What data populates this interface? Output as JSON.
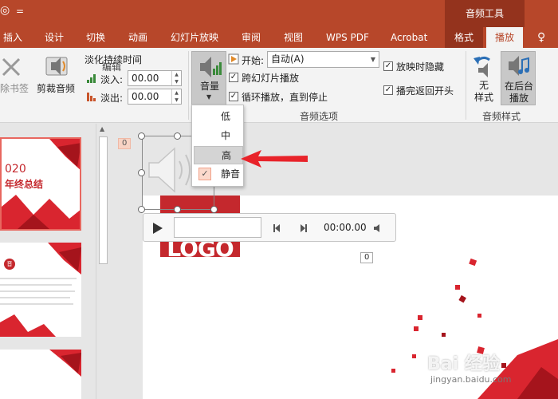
{
  "titlebar": {
    "qa_dropdown": "=",
    "context_group": "音频工具"
  },
  "tabs": [
    "插入",
    "设计",
    "切换",
    "动画",
    "幻灯片放映",
    "审阅",
    "视图",
    "WPS PDF",
    "Acrobat",
    "格式",
    "播放"
  ],
  "help_glyph": "♀",
  "ribbon": {
    "bookmark_label": "除书签",
    "trim_label": "剪裁音频",
    "fade_title": "淡化持续时间",
    "fade_in_label": "淡入:",
    "fade_in_value": "00.00",
    "fade_out_label": "淡出:",
    "fade_out_value": "00.00",
    "edit_group": "编辑",
    "volume_label": "音量",
    "start_label": "开始:",
    "start_value": "自动(A)",
    "cross_slides_label": "跨幻灯片播放",
    "loop_label": "循环播放，直到停止",
    "hide_label": "放映时隐藏",
    "rewind_label": "播完返回开头",
    "audio_options_group": "音频选项",
    "none_style_line1": "无",
    "none_style_line2": "样式",
    "bg_line1": "在后台",
    "bg_line2": "播放",
    "audio_style_group": "音频样式",
    "check_mark": "✓"
  },
  "volume_menu": {
    "items": [
      "低",
      "中",
      "高",
      "静音"
    ],
    "check_mark": "✓"
  },
  "slide_thumbs": {
    "thumb1_year": "020",
    "thumb1_title": "年终总结",
    "thumb2_badge": "音"
  },
  "canvas": {
    "badge_audio": "0",
    "badge_media": "0",
    "slide_logo_text": "LOGO",
    "player_time": "00:00.00"
  },
  "watermark": {
    "main": "Bai 经验",
    "sub": "jingyan.baidu.com"
  },
  "colors": {
    "accent": "#b7472a",
    "accent_dark": "#94331d",
    "arrow_red": "#e8232a"
  }
}
